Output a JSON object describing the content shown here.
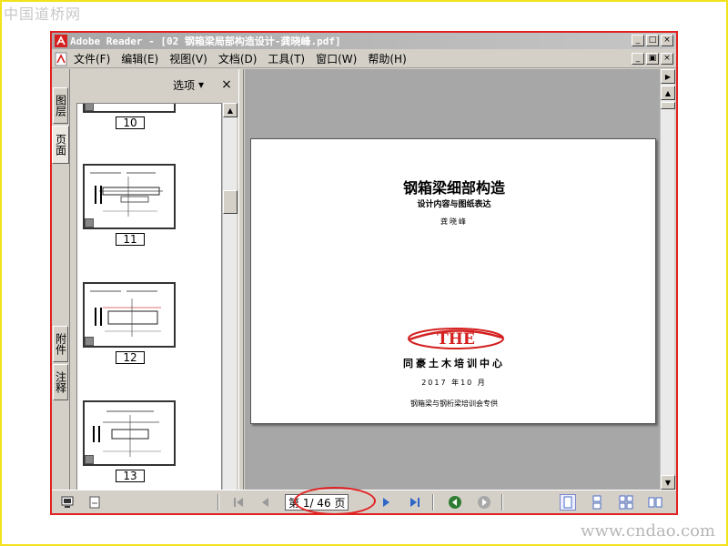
{
  "watermark": {
    "logo_text": "中国道桥网",
    "url_text": "www.cndao.com"
  },
  "window": {
    "title": "Adobe Reader - [02 钢箱梁局部构造设计-龚晓峰.pdf]",
    "minimize_glyph": "_",
    "maximize_glyph": "□",
    "close_glyph": "×",
    "restore_glyph": "▣"
  },
  "menu": {
    "items": [
      {
        "label": "文件(F)"
      },
      {
        "label": "编辑(E)"
      },
      {
        "label": "视图(V)"
      },
      {
        "label": "文档(D)"
      },
      {
        "label": "工具(T)"
      },
      {
        "label": "窗口(W)"
      },
      {
        "label": "帮助(H)"
      }
    ]
  },
  "side_tabs": {
    "layers": "图层",
    "pages": "页面",
    "attachments": "附件",
    "comments": "注释"
  },
  "nav_pane": {
    "options_label": "选项",
    "options_arrow": "▾",
    "close_label": "×",
    "thumbnails": [
      {
        "label": "10"
      },
      {
        "label": "11"
      },
      {
        "label": "12"
      },
      {
        "label": "13"
      }
    ]
  },
  "document": {
    "title": "钢箱梁细部构造",
    "subtitle": "设计内容与图纸表达",
    "author": "龚晓峰",
    "logo_text": "THE",
    "org_name": "同豪土木培训中心",
    "date": "2017 年10 月",
    "note": "钢箱梁与钢桁梁培训会专供"
  },
  "status_bar": {
    "page_display": "第 1/ 46 页",
    "current_page": 1,
    "total_pages": 46
  },
  "colors": {
    "window_border": "#e12222",
    "frame_border": "#f2e21a",
    "doc_background": "#a7a7a7",
    "logo_red": "#d42020",
    "nav_green": "#2e7d32"
  }
}
